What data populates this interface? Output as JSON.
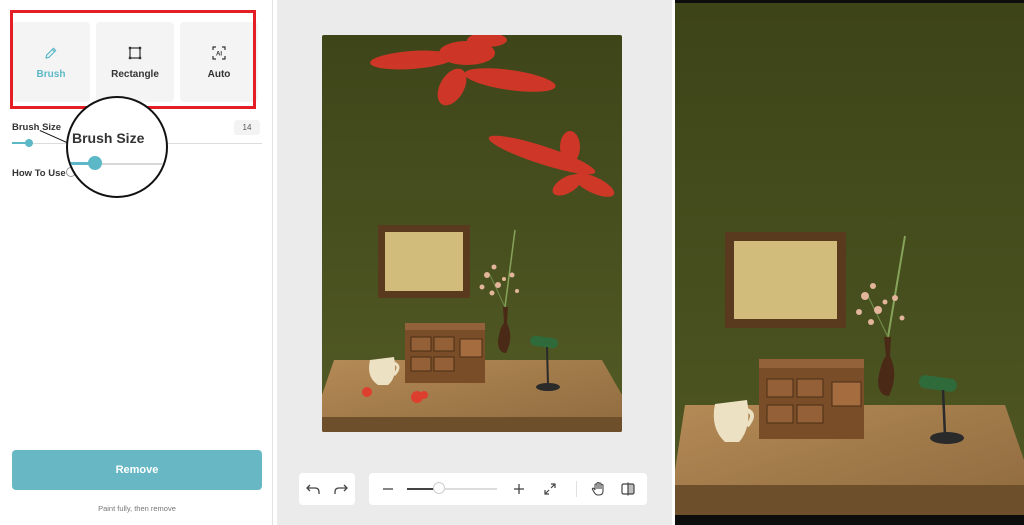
{
  "tools": [
    {
      "label": "Brush",
      "icon": "pencil-icon",
      "active": true
    },
    {
      "label": "Rectangle",
      "icon": "rectangle-select-icon",
      "active": false
    },
    {
      "label": "Auto",
      "icon": "ai-select-icon",
      "active": false
    }
  ],
  "brush_size": {
    "label": "Brush Size",
    "value": "14",
    "level_percent": 7
  },
  "magnifier": {
    "label": "Brush Size"
  },
  "how_to_use": {
    "label": "How To Use"
  },
  "remove_button": {
    "label": "Remove"
  },
  "hint": "Paint fully, then remove",
  "zoom": {
    "level_percent": 30
  },
  "colors": {
    "accent": "#5cb8c6",
    "button": "#67b7c4",
    "highlight_frame": "#e31e24",
    "mask_paint": "#e8342a",
    "wall": "#4a5220"
  }
}
